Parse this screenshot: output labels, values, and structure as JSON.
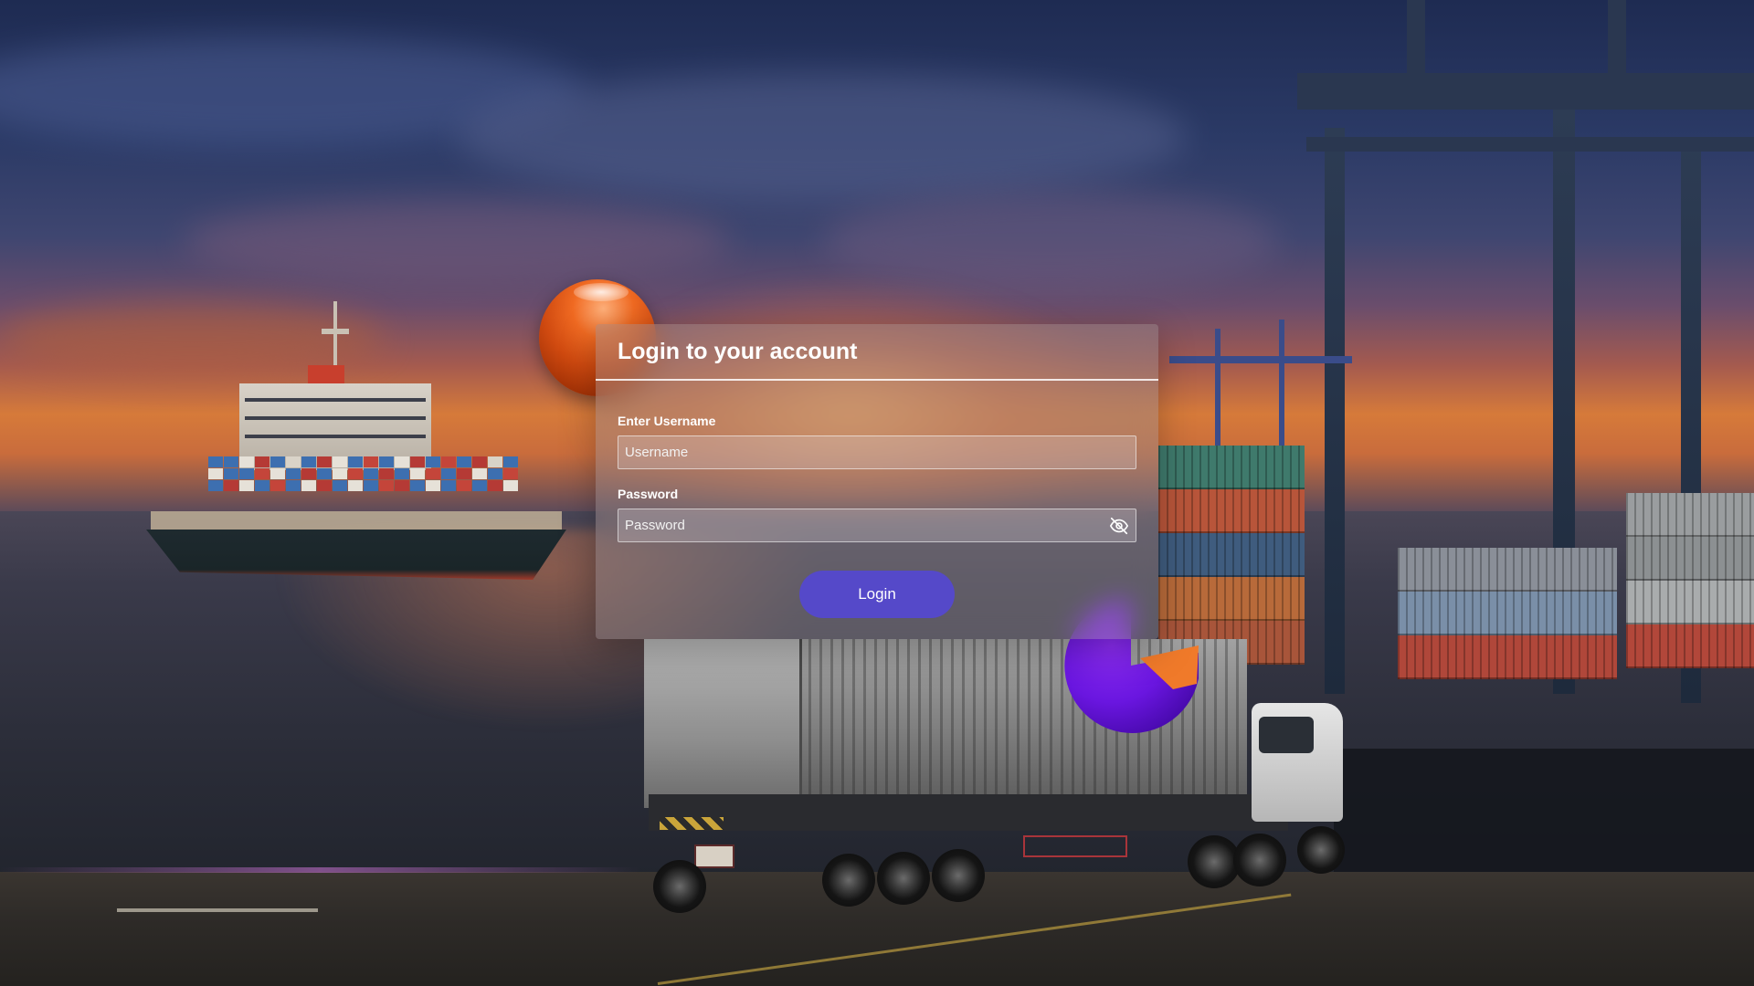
{
  "login": {
    "title": "Login to your account",
    "username": {
      "label": "Enter Username",
      "placeholder": "Username",
      "value": ""
    },
    "password": {
      "label": "Password",
      "placeholder": "Password",
      "value": "",
      "toggle_icon": "eye-off-icon"
    },
    "submit_label": "Login"
  },
  "colors": {
    "button": "#5549c9",
    "orb": "#f06a22",
    "pie_purple": "#6a16e0",
    "pie_orange": "#f07a2a"
  }
}
